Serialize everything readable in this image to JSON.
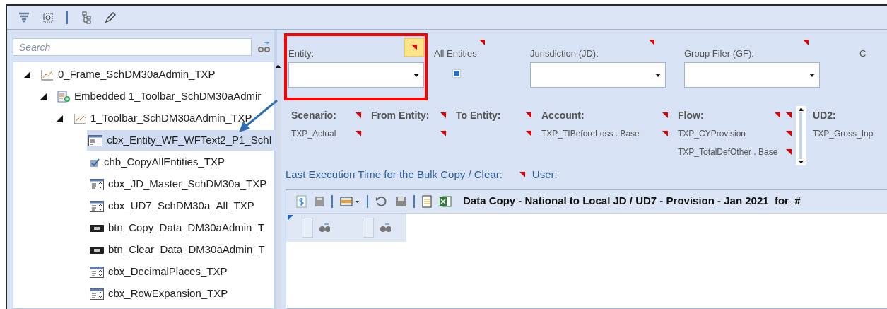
{
  "toolbar": {
    "buttons": [
      {
        "kind": "filter"
      },
      {
        "kind": "select"
      },
      {
        "kind": "tree"
      },
      {
        "kind": "edit"
      }
    ]
  },
  "search": {
    "placeholder": "Search"
  },
  "tree": [
    {
      "label": "0_Frame_SchDM30aAdmin_TXP",
      "kind": "chart",
      "expanded": true,
      "selected": false,
      "children": [
        {
          "label": "Embedded 1_Toolbar_SchDM30aAdmir",
          "kind": "embedded",
          "expanded": true,
          "selected": false,
          "children": [
            {
              "label": "1_Toolbar_SchDM30aAdmin_TXP",
              "kind": "chart",
              "expanded": true,
              "selected": false,
              "children": [
                {
                  "label": "cbx_Entity_WF_WFText2_P1_SchI",
                  "kind": "combobox",
                  "selected": true
                },
                {
                  "label": "chb_CopyAllEntities_TXP",
                  "kind": "checkbox",
                  "selected": false
                },
                {
                  "label": "cbx_JD_Master_SchDM30a_TXP",
                  "kind": "combobox",
                  "selected": false
                },
                {
                  "label": "cbx_UD7_SchDM30a_All_TXP",
                  "kind": "combobox",
                  "selected": false
                },
                {
                  "label": "btn_Copy_Data_DM30aAdmin_T",
                  "kind": "button",
                  "selected": false
                },
                {
                  "label": "btn_Clear_Data_DM30aAdmin_T",
                  "kind": "button",
                  "selected": false
                },
                {
                  "label": "cbx_DecimalPlaces_TXP",
                  "kind": "combobox",
                  "selected": false
                },
                {
                  "label": "cbx_RowExpansion_TXP",
                  "kind": "combobox",
                  "selected": false
                }
              ]
            }
          ]
        }
      ]
    }
  ],
  "filters": [
    {
      "kind": "dropdown",
      "label": "Entity:"
    },
    {
      "kind": "checkbox",
      "label": "All Entities",
      "checked": false
    },
    {
      "kind": "dropdown",
      "label": "Jurisdiction (JD):"
    },
    {
      "kind": "dropdown",
      "label": "Group Filer (GF):"
    },
    {
      "kind": "cut",
      "label": "C"
    }
  ],
  "parameters": [
    {
      "label": "Scenario:",
      "values": [
        "TXP_Actual"
      ]
    },
    {
      "label": "From Entity:"
    },
    {
      "label": "To Entity:"
    },
    {
      "label": "Account:",
      "values": [
        "TXP_TIBeforeLoss . Base"
      ]
    },
    {
      "label": "Flow:",
      "values": [
        "TXP_CYProvision",
        "TXP_TotalDefOther . Base"
      ]
    },
    {
      "label": "UD2:",
      "values": [
        "TXP_Gross_Inp"
      ]
    }
  ],
  "last_execution": {
    "label": "Last Execution Time for the Bulk Copy / Clear:",
    "user_label": "User:"
  },
  "grid": {
    "title": "Data Copy - National to Local JD / UD7 - Provision - Jan 2021  for  #"
  }
}
